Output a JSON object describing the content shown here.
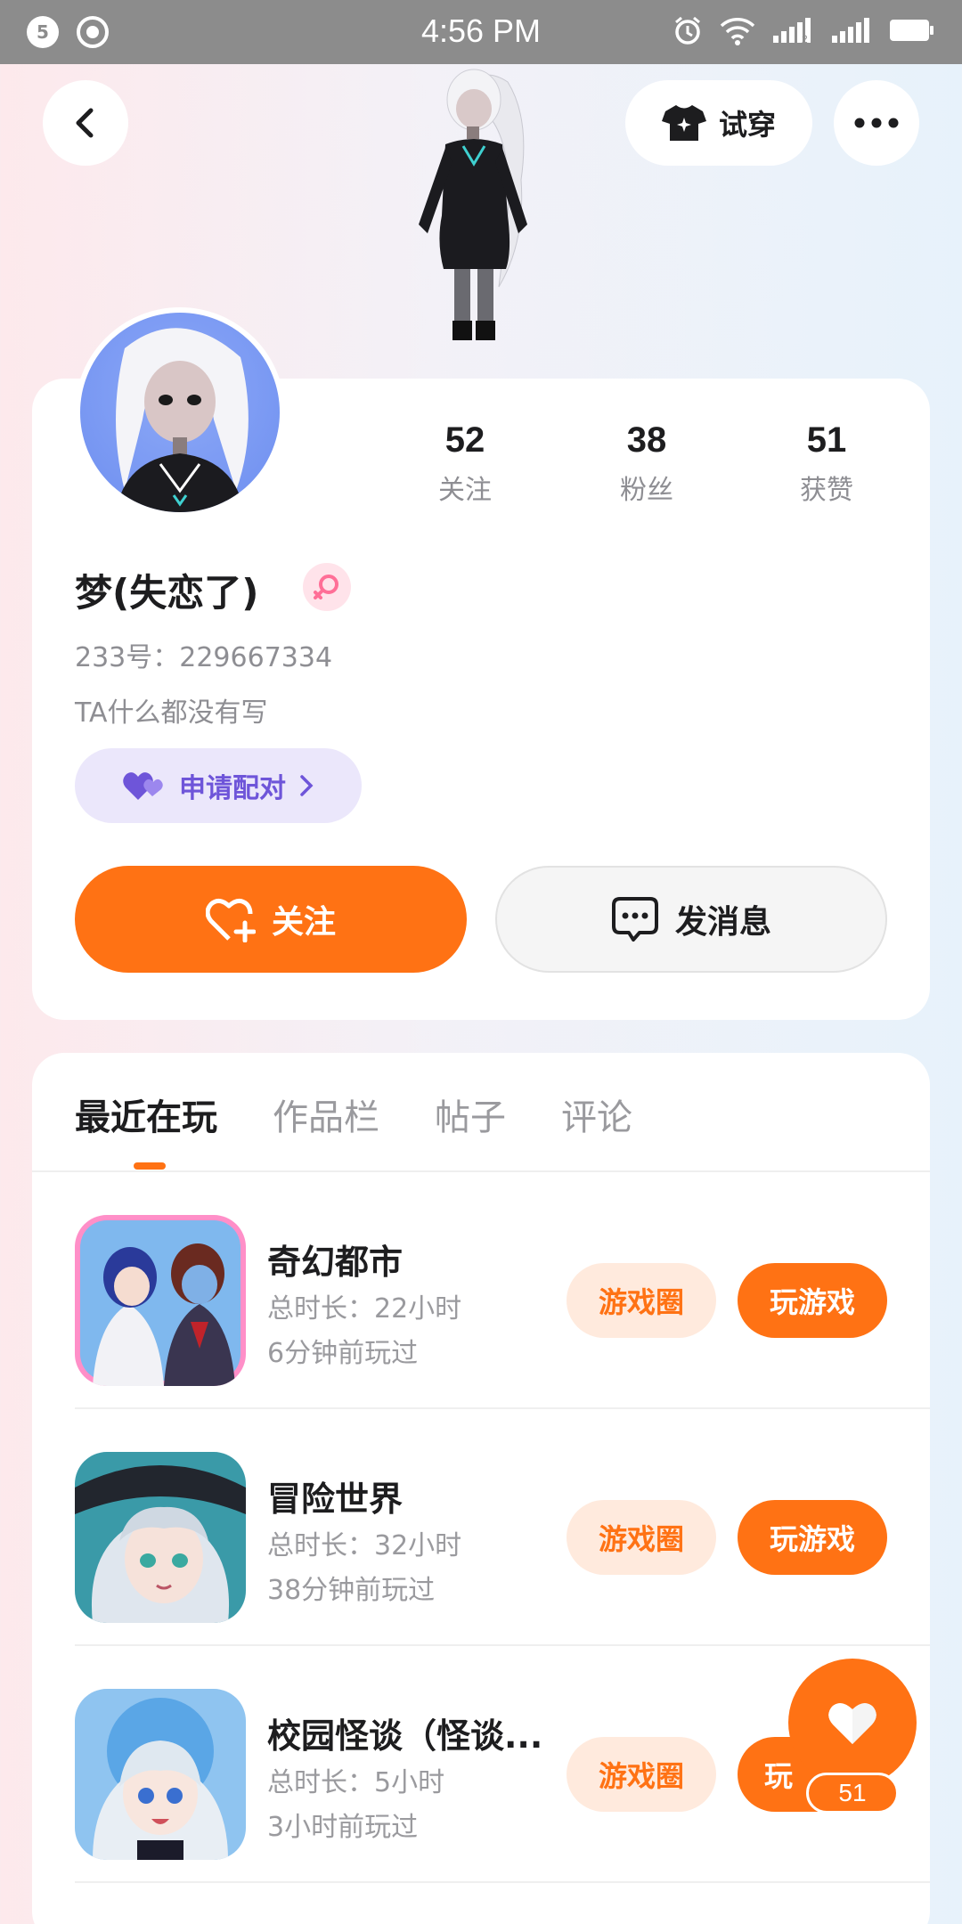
{
  "status_bar": {
    "time": "4:56 PM",
    "notif_count": "5",
    "sim2_label": "2"
  },
  "header": {
    "tryon_label": "试穿"
  },
  "profile": {
    "stats": [
      {
        "value": "52",
        "label": "关注"
      },
      {
        "value": "38",
        "label": "粉丝"
      },
      {
        "value": "51",
        "label": "获赞"
      }
    ],
    "username": "梦(失恋了)",
    "uid": "233号：229667334",
    "bio": "TA什么都没有写",
    "pair_label": "申请配对",
    "follow_label": "关注",
    "message_label": "发消息"
  },
  "tabs": [
    {
      "label": "最近在玩",
      "active": true
    },
    {
      "label": "作品栏",
      "active": false
    },
    {
      "label": "帖子",
      "active": false
    },
    {
      "label": "评论",
      "active": false
    }
  ],
  "games": [
    {
      "name": "奇幻都市",
      "duration": "总时长：22小时",
      "last_played": "6分钟前玩过",
      "circle_label": "游戏圈",
      "play_label": "玩游戏"
    },
    {
      "name": "冒险世界",
      "duration": "总时长：32小时",
      "last_played": "38分钟前玩过",
      "circle_label": "游戏圈",
      "play_label": "玩游戏"
    },
    {
      "name": "校园怪谈（怪谈...",
      "duration": "总时长：5小时",
      "last_played": "3小时前玩过",
      "circle_label": "游戏圈",
      "play_label": "玩"
    }
  ],
  "like_fab": {
    "count": "51"
  },
  "colors": {
    "accent": "#ff7214",
    "pair_purple": "#6e55d9",
    "muted_text": "#8e8e93"
  }
}
